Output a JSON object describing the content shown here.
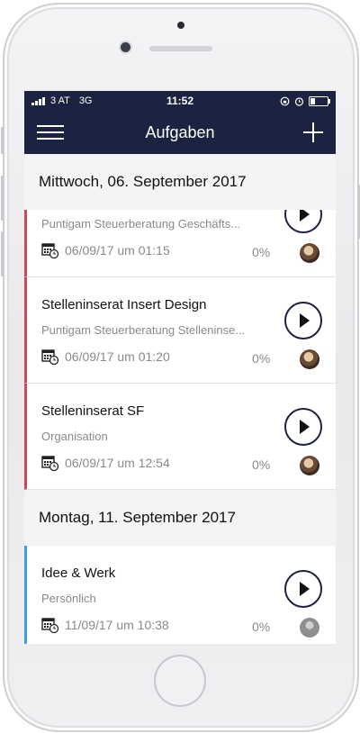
{
  "status_bar": {
    "carrier": "3 AT",
    "network": "3G",
    "time": "11:52",
    "battery_level": 0.25
  },
  "nav": {
    "title": "Aufgaben"
  },
  "sections": [
    {
      "header": "Mittwoch, 06. September 2017",
      "tasks": [
        {
          "title": "",
          "subtitle": "Puntigam Steuerberatung Geschäfts...",
          "date": "06/09/17 um 01:15",
          "progress": "0%"
        },
        {
          "title": "Stelleninserat Insert Design",
          "subtitle": "Puntigam Steuerberatung Stelleninse...",
          "date": "06/09/17 um 01:20",
          "progress": "0%"
        },
        {
          "title": "Stelleninserat SF",
          "subtitle": "Organisation",
          "date": "06/09/17 um 12:54",
          "progress": "0%"
        }
      ]
    },
    {
      "header": "Montag, 11. September 2017",
      "tasks": [
        {
          "title": "Idee & Werk",
          "subtitle": "Persönlich",
          "date": "11/09/17 um 10:38",
          "progress": "0%"
        }
      ]
    }
  ],
  "colors": {
    "navbar": "#1c2341",
    "overdue_bar": "#d9434c",
    "upcoming_bar": "#3aa0da"
  }
}
